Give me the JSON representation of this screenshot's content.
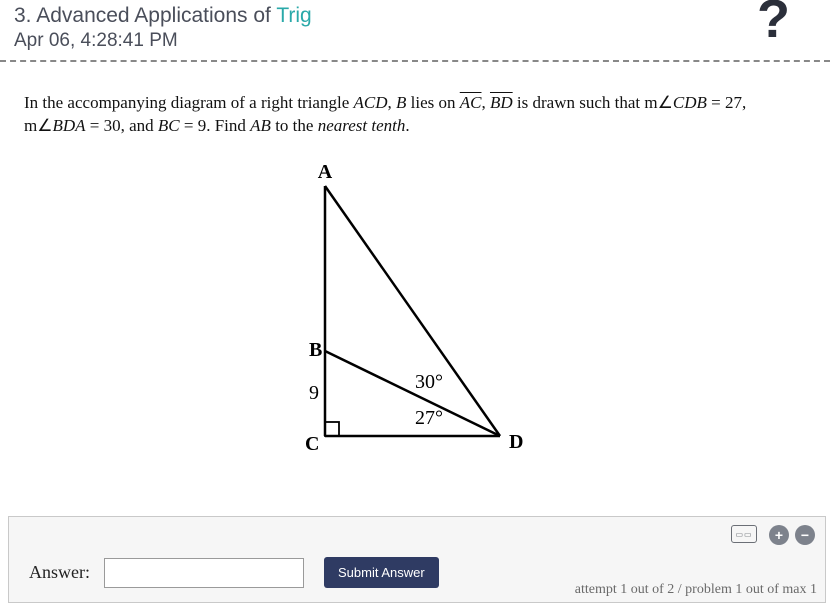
{
  "header": {
    "number": "3.",
    "title_plain": "Advanced Applications of ",
    "title_hl": "Trig",
    "timestamp": "Apr 06, 4:28:41 PM",
    "help": "?"
  },
  "problem": {
    "text_pre": "In the accompanying diagram of a right triangle ",
    "tri": "ACD",
    "text_mid1": ", ",
    "b_": "B",
    "text_mid2": " lies on ",
    "seg_ac": "AC",
    "text_mid3": ", ",
    "seg_bd": "BD",
    "text_mid4": " is drawn such that m∠",
    "ang1": "CDB",
    "text_mid5": " = 27, m∠",
    "ang2": "BDA",
    "text_mid6": " = 30, and ",
    "bc": "BC",
    "text_mid7": " = 9.  Find ",
    "ab": "AB",
    "text_end": " to the ",
    "nearest": "nearest tenth",
    "period": "."
  },
  "diagram": {
    "A": "A",
    "B": "B",
    "C": "C",
    "D": "D",
    "nine": "9",
    "thirty": "30°",
    "twentyseven": "27°"
  },
  "footer": {
    "answer_label": "Answer:",
    "answer_value": "",
    "submit": "Submit Answer",
    "plus": "+",
    "minus": "−",
    "attempt": "attempt 1 out of 2 / problem 1 out of max 1"
  }
}
